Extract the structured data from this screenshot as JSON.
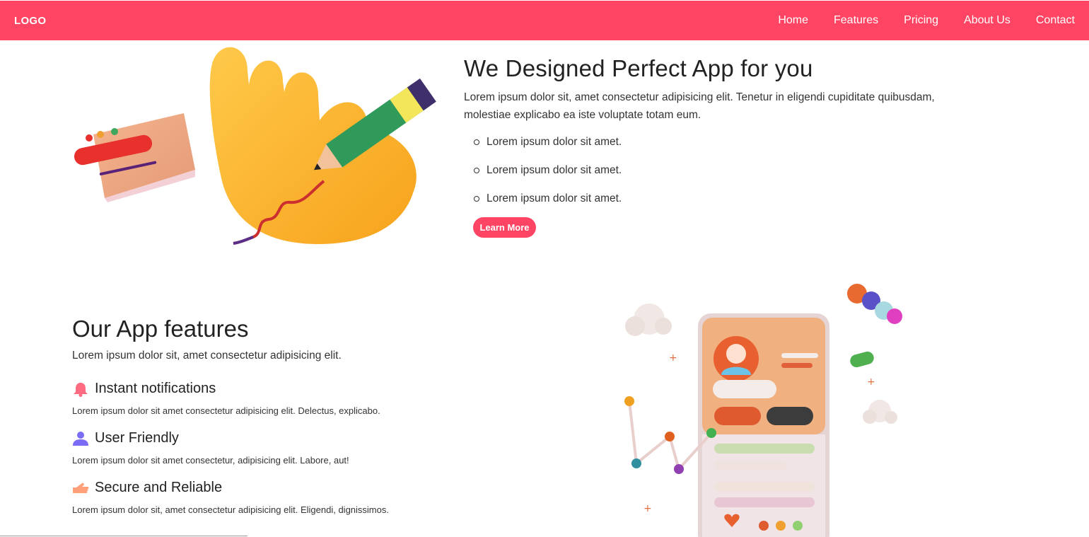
{
  "navbar": {
    "logo": "LOGO",
    "links": [
      "Home",
      "Features",
      "Pricing",
      "About Us",
      "Contact"
    ]
  },
  "hero": {
    "title": "We Designed Perfect App for you",
    "description": "Lorem ipsum dolor sit, amet consectetur adipisicing elit. Tenetur in eligendi cupiditate quibusdam, molestiae explicabo ea iste voluptate totam eum.",
    "list": [
      "Lorem ipsum dolor sit amet.",
      "Lorem ipsum dolor sit amet.",
      "Lorem ipsum dolor sit amet."
    ],
    "button": "Learn More"
  },
  "features": {
    "title": "Our App features",
    "description": "Lorem ipsum dolor sit, amet consectetur adipisicing elit.",
    "items": [
      {
        "title": "Instant notifications",
        "description": "Lorem ipsum dolor sit amet consectetur adipisicing elit. Delectus, explicabo.",
        "icon": "bell-icon"
      },
      {
        "title": "User Friendly",
        "description": "Lorem ipsum dolor sit amet consectetur, adipisicing elit. Labore, aut!",
        "icon": "user-icon"
      },
      {
        "title": "Secure and Reliable",
        "description": "Lorem ipsum dolor sit, amet consectetur adipisicing elit. Eligendi, dignissimos.",
        "icon": "hand-icon"
      }
    ]
  },
  "colors": {
    "accent": "#ff4563",
    "bell": "#ff6b81",
    "user": "#7b6cf6",
    "hand": "#ffa07a"
  }
}
